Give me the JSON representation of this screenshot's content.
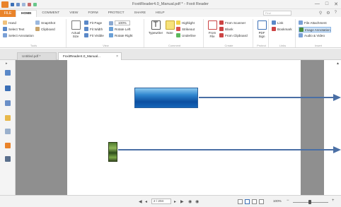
{
  "window": {
    "title": "FoxitReader4.0_Manual.pdf * - Foxit Reader",
    "controls": [
      "—",
      "□",
      "✕"
    ]
  },
  "ribbon_tabs": [
    {
      "label": "FILE",
      "active": false
    },
    {
      "label": "HOME",
      "active": true
    },
    {
      "label": "COMMENT",
      "active": false
    },
    {
      "label": "VIEW",
      "active": false
    },
    {
      "label": "FORM",
      "active": false
    },
    {
      "label": "PROTECT",
      "active": false
    },
    {
      "label": "SHARE",
      "active": false
    },
    {
      "label": "HELP",
      "active": false
    }
  ],
  "search_placeholder": "Find",
  "ribbon": {
    "tools_group": {
      "label": "Tools",
      "hand": "Hand",
      "select_text": "Select Text",
      "select_annotation": "Select Annotation",
      "snapshot": "SnapShot",
      "clipboard": "Clipboard"
    },
    "view_group": {
      "label": "View",
      "actual_size": "Actual Size",
      "fit_page": "Fit Page",
      "fit_width": "Fit Width",
      "fit_visible": "Fit Visible",
      "zoom_value": "100%",
      "rotate_left": "Rotate Left",
      "rotate_right": "Rotate Right"
    },
    "comment_group": {
      "label": "Comment",
      "typewriter": "Typewriter",
      "note": "Note",
      "highlight": "Highlight",
      "strikeout": "Strikeout",
      "underline": "Underline"
    },
    "create_group": {
      "label": "Create",
      "from_file": "From File",
      "from_scanner": "From Scanner",
      "blank": "Blank",
      "from_clipboard": "From Clipboard"
    },
    "protect_group": {
      "label": "Protect",
      "pdf_sign": "PDF Sign"
    },
    "links_group": {
      "label": "Links",
      "link": "Link",
      "bookmark": "Bookmark"
    },
    "insert_group": {
      "label": "Insert",
      "file_attachment": "File Attachment",
      "image_annotation": "Image Annotation",
      "audio_video": "Audio & Video"
    }
  },
  "doc_tabs": [
    {
      "label": "Untitled.pdf *",
      "active": false
    },
    {
      "label": "FoxitReader4.0_Manual...",
      "active": true
    }
  ],
  "status": {
    "page_field": "2 / 204",
    "zoom": "100%"
  },
  "colors": {
    "accent": "#e9832a",
    "arrow": "#4a6fa5",
    "page_gray": "#8f8f8f"
  }
}
